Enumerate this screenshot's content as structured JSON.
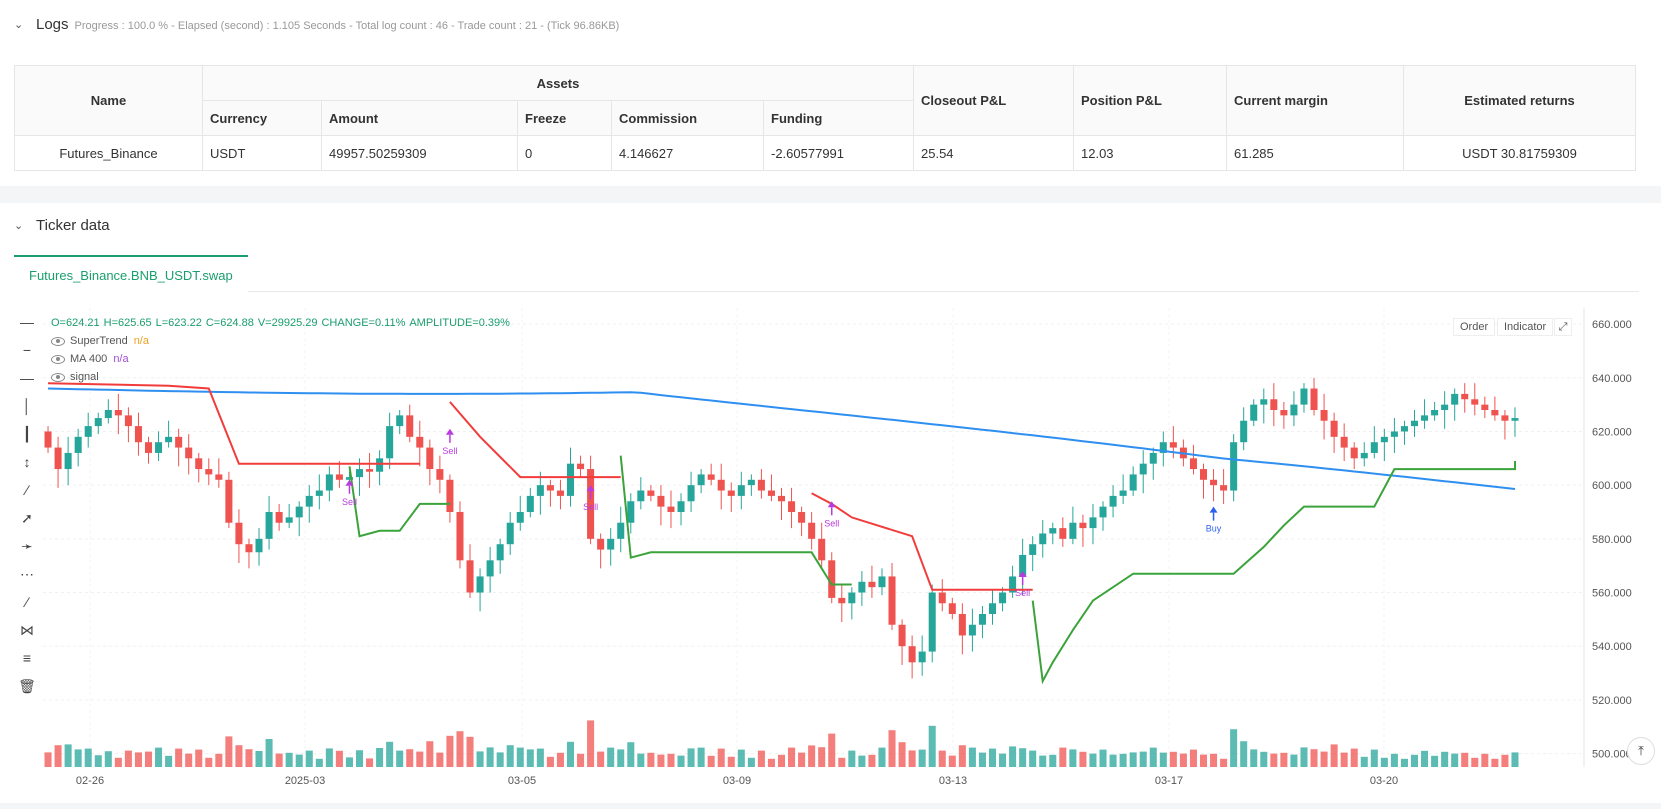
{
  "logs": {
    "title": "Logs",
    "summary": "Progress : 100.0 % - Elapsed (second) : 1.105  Seconds - Total log count : 46 - Trade count : 21 - (Tick 96.86KB)"
  },
  "assets_table": {
    "group_header": "Assets",
    "headers": {
      "name": "Name",
      "currency": "Currency",
      "amount": "Amount",
      "freeze": "Freeze",
      "commission": "Commission",
      "funding": "Funding",
      "closeout": "Closeout P&L",
      "position": "Position P&L",
      "margin": "Current margin",
      "returns": "Estimated returns"
    },
    "row": {
      "name": "Futures_Binance",
      "currency": "USDT",
      "amount": "49957.50259309",
      "freeze": "0",
      "commission": "4.146627",
      "funding": "-2.60577991",
      "closeout": "25.54",
      "position": "12.03",
      "margin": "61.285",
      "returns": "USDT 30.81759309"
    }
  },
  "ticker": {
    "title": "Ticker data",
    "tab": "Futures_Binance.BNB_USDT.swap",
    "ohlc": {
      "o": "O=624.21",
      "h": "H=625.65",
      "l": "L=623.22",
      "c": "C=624.88",
      "v": "V=29925.29",
      "change": "CHANGE=0.11%",
      "amplitude": "AMPLITUDE=0.39%"
    },
    "indicators": [
      {
        "name": "SuperTrend",
        "value": "n/a"
      },
      {
        "name": "MA 400",
        "value": "n/a"
      },
      {
        "name": "signal",
        "value": ""
      }
    ],
    "buttons": {
      "order": "Order",
      "indicator": "Indicator"
    }
  },
  "colors": {
    "up": "#26a69a",
    "down": "#ef5350",
    "ma": "#2f8ff0",
    "st_up": "#3ba33b",
    "st_down": "#f23c3c",
    "signal_sell": "#b93ae0",
    "signal_buy": "#2b5ff0"
  },
  "chart_data": {
    "type": "candlestick",
    "y_ticks": [
      "660.000",
      "640.000",
      "620.000",
      "600.000",
      "580.000",
      "560.000",
      "540.000",
      "520.000",
      "500.000"
    ],
    "ylim": [
      495,
      666
    ],
    "x_ticks": [
      "02-26",
      "2025-03",
      "03-05",
      "03-09",
      "03-13",
      "03-17",
      "03-20"
    ],
    "signals": [
      {
        "label": "Sell",
        "type": "sell",
        "price": 602
      },
      {
        "label": "Sell",
        "type": "sell",
        "price": 621
      },
      {
        "label": "Sell",
        "type": "sell",
        "price": 600
      },
      {
        "label": "Sell",
        "type": "sell",
        "price": 594
      },
      {
        "label": "Sell",
        "type": "sell",
        "price": 568
      },
      {
        "label": "Buy",
        "type": "buy",
        "price": 592
      }
    ],
    "closes": [
      614,
      606,
      612,
      618,
      622,
      625,
      628,
      626,
      622,
      616,
      612,
      616,
      618,
      614,
      610,
      606,
      604,
      602,
      586,
      578,
      575,
      580,
      590,
      586,
      588,
      592,
      596,
      598,
      604,
      602,
      603,
      606,
      605,
      610,
      622,
      626,
      618,
      614,
      606,
      602,
      590,
      572,
      560,
      566,
      572,
      578,
      586,
      590,
      596,
      600,
      598,
      596,
      608,
      606,
      580,
      576,
      580,
      586,
      594,
      598,
      596,
      592,
      590,
      594,
      600,
      604,
      602,
      598,
      596,
      600,
      602,
      598,
      596,
      594,
      590,
      586,
      580,
      572,
      558,
      556,
      560,
      564,
      562,
      566,
      548,
      540,
      534,
      538,
      560,
      556,
      552,
      544,
      548,
      552,
      556,
      560,
      566,
      574,
      578,
      582,
      584,
      580,
      586,
      584,
      588,
      592,
      596,
      598,
      604,
      608,
      612,
      616,
      614,
      610,
      606,
      602,
      600,
      598,
      616,
      624,
      630,
      632,
      628,
      626,
      630,
      636,
      628,
      624,
      618,
      614,
      610,
      612,
      616,
      618,
      620,
      622,
      624,
      626,
      628,
      630,
      634,
      632,
      630,
      628,
      626,
      624,
      625
    ]
  }
}
